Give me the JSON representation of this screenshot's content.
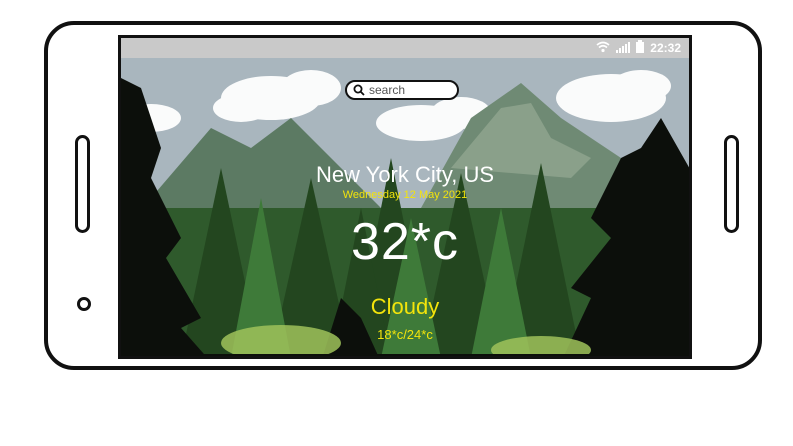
{
  "statusbar": {
    "time": "22:32",
    "icons": [
      "wifi-icon",
      "signal-icon",
      "battery-icon"
    ]
  },
  "search": {
    "placeholder": "search"
  },
  "weather": {
    "city": "New York City, US",
    "date": "Wednesday 12 May 2021",
    "temperature": "32*c",
    "condition": "Cloudy",
    "range": "18*c/24*c"
  },
  "colors": {
    "accent_yellow": "#f3e40b",
    "text_white": "#ffffff",
    "statusbar_bg": "#c9c9c9"
  }
}
